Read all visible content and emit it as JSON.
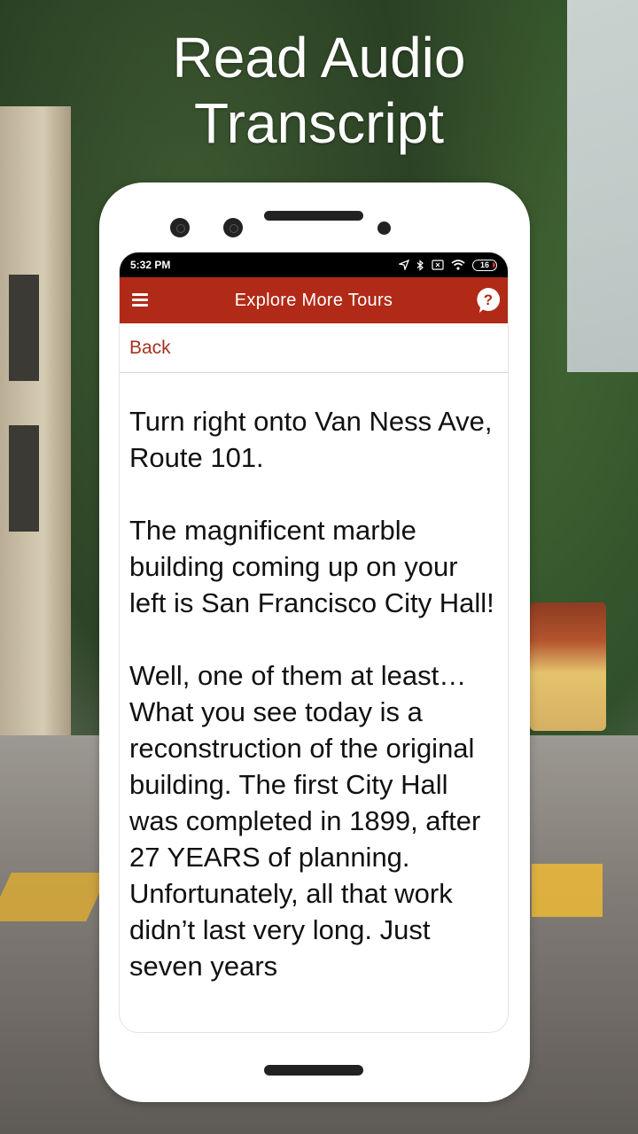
{
  "headline": {
    "line1": "Read Audio",
    "line2": "Transcript"
  },
  "status_bar": {
    "time": "5:32 PM",
    "icons": [
      "location-icon",
      "bluetooth-icon",
      "notification-icon",
      "wifi-icon",
      "battery-icon"
    ],
    "battery_level": "16"
  },
  "app_bar": {
    "menu_icon": "hamburger-menu-icon",
    "title": "Explore More Tours",
    "help_icon": "help-bubble-icon",
    "color": "#b12a17"
  },
  "navigation": {
    "back_label": "Back",
    "back_color": "#a63220"
  },
  "transcript": {
    "paragraphs": [
      "Turn right onto Van Ness Ave, Route 101.",
      "The magnificent marble building coming up on your left is San Francisco City Hall!",
      "Well, one of them at least… What you see today is a reconstruction of the original building. The first City Hall was completed in 1899, after 27 YEARS of planning. Unfortunately, all that work didn’t last very long. Just seven years"
    ]
  }
}
